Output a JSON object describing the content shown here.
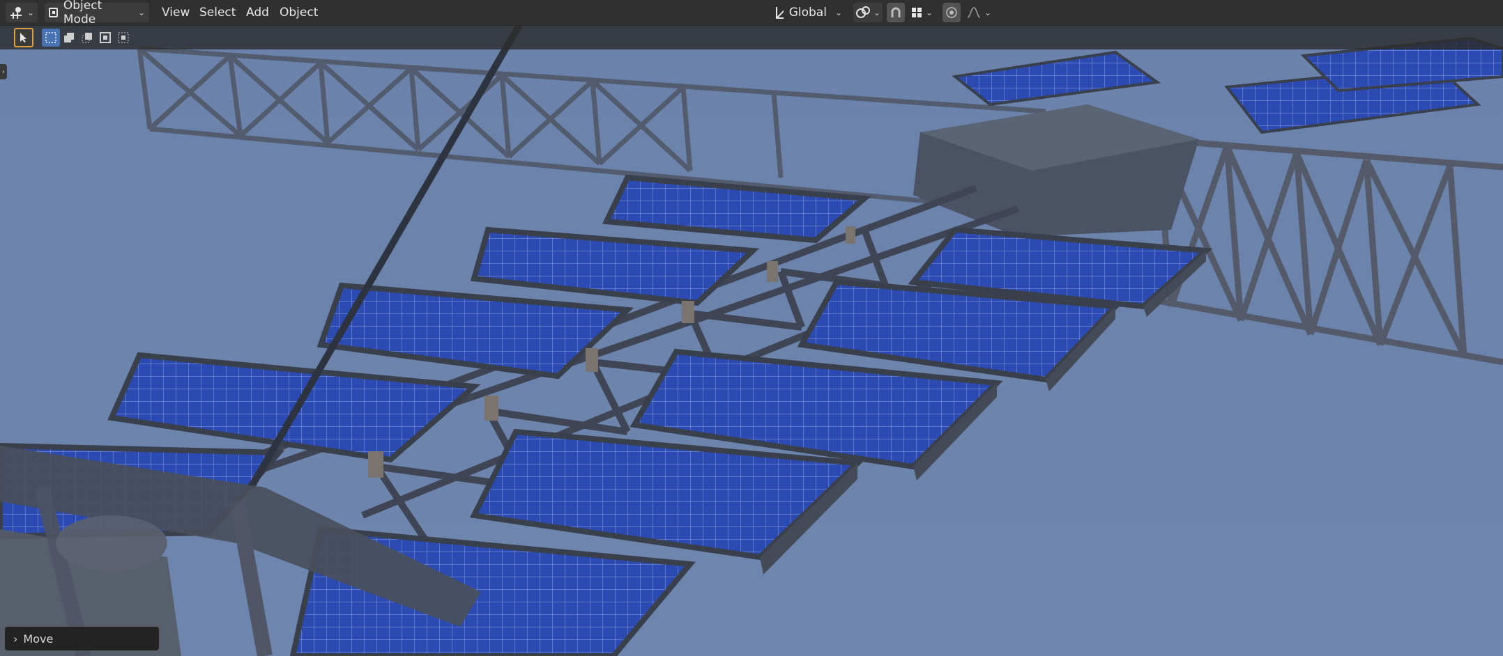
{
  "header": {
    "editor_type_icon": "object-editor-icon",
    "mode_label": "Object Mode",
    "menus": [
      "View",
      "Select",
      "Add",
      "Object"
    ],
    "orientation_label": "Global",
    "pivot_icon": "pivot-link-icon",
    "snap_icon": "snap-magnet-icon",
    "snap_element_icon": "snap-increment-icon",
    "proportional_edit_icon": "proportional-edit-icon",
    "falloff_icon": "falloff-curve-icon"
  },
  "toolbar": {
    "tools": [
      {
        "name": "select-tool",
        "icon": "cursor-select-icon",
        "active": true
      },
      {
        "name": "mode-new",
        "icon": "select-new-icon",
        "active": true
      },
      {
        "name": "mode-extend",
        "icon": "select-extend-icon",
        "active": false
      },
      {
        "name": "mode-subtract",
        "icon": "select-subtract-icon",
        "active": false
      },
      {
        "name": "mode-invert",
        "icon": "select-invert-icon",
        "active": false
      },
      {
        "name": "mode-intersect",
        "icon": "select-intersect-icon",
        "active": false
      }
    ]
  },
  "last_operator": {
    "label": "Move"
  },
  "colors": {
    "header_bg": "#303030",
    "viewport_sky": "#6f86ad",
    "panel_blue": "#2e4fb0",
    "truss_gray": "#4a5060",
    "active_tool_outline": "#e0a040"
  }
}
